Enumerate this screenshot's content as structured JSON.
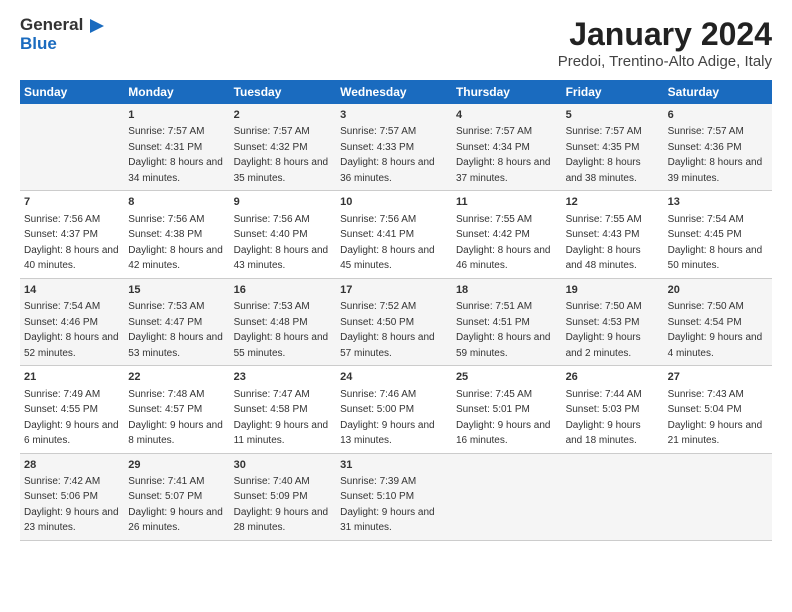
{
  "logo": {
    "line1": "General",
    "line2": "Blue"
  },
  "title": "January 2024",
  "subtitle": "Predoi, Trentino-Alto Adige, Italy",
  "headers": [
    "Sunday",
    "Monday",
    "Tuesday",
    "Wednesday",
    "Thursday",
    "Friday",
    "Saturday"
  ],
  "weeks": [
    [
      {
        "num": "",
        "sunrise": "",
        "sunset": "",
        "daylight": ""
      },
      {
        "num": "1",
        "sunrise": "Sunrise: 7:57 AM",
        "sunset": "Sunset: 4:31 PM",
        "daylight": "Daylight: 8 hours and 34 minutes."
      },
      {
        "num": "2",
        "sunrise": "Sunrise: 7:57 AM",
        "sunset": "Sunset: 4:32 PM",
        "daylight": "Daylight: 8 hours and 35 minutes."
      },
      {
        "num": "3",
        "sunrise": "Sunrise: 7:57 AM",
        "sunset": "Sunset: 4:33 PM",
        "daylight": "Daylight: 8 hours and 36 minutes."
      },
      {
        "num": "4",
        "sunrise": "Sunrise: 7:57 AM",
        "sunset": "Sunset: 4:34 PM",
        "daylight": "Daylight: 8 hours and 37 minutes."
      },
      {
        "num": "5",
        "sunrise": "Sunrise: 7:57 AM",
        "sunset": "Sunset: 4:35 PM",
        "daylight": "Daylight: 8 hours and 38 minutes."
      },
      {
        "num": "6",
        "sunrise": "Sunrise: 7:57 AM",
        "sunset": "Sunset: 4:36 PM",
        "daylight": "Daylight: 8 hours and 39 minutes."
      }
    ],
    [
      {
        "num": "7",
        "sunrise": "Sunrise: 7:56 AM",
        "sunset": "Sunset: 4:37 PM",
        "daylight": "Daylight: 8 hours and 40 minutes."
      },
      {
        "num": "8",
        "sunrise": "Sunrise: 7:56 AM",
        "sunset": "Sunset: 4:38 PM",
        "daylight": "Daylight: 8 hours and 42 minutes."
      },
      {
        "num": "9",
        "sunrise": "Sunrise: 7:56 AM",
        "sunset": "Sunset: 4:40 PM",
        "daylight": "Daylight: 8 hours and 43 minutes."
      },
      {
        "num": "10",
        "sunrise": "Sunrise: 7:56 AM",
        "sunset": "Sunset: 4:41 PM",
        "daylight": "Daylight: 8 hours and 45 minutes."
      },
      {
        "num": "11",
        "sunrise": "Sunrise: 7:55 AM",
        "sunset": "Sunset: 4:42 PM",
        "daylight": "Daylight: 8 hours and 46 minutes."
      },
      {
        "num": "12",
        "sunrise": "Sunrise: 7:55 AM",
        "sunset": "Sunset: 4:43 PM",
        "daylight": "Daylight: 8 hours and 48 minutes."
      },
      {
        "num": "13",
        "sunrise": "Sunrise: 7:54 AM",
        "sunset": "Sunset: 4:45 PM",
        "daylight": "Daylight: 8 hours and 50 minutes."
      }
    ],
    [
      {
        "num": "14",
        "sunrise": "Sunrise: 7:54 AM",
        "sunset": "Sunset: 4:46 PM",
        "daylight": "Daylight: 8 hours and 52 minutes."
      },
      {
        "num": "15",
        "sunrise": "Sunrise: 7:53 AM",
        "sunset": "Sunset: 4:47 PM",
        "daylight": "Daylight: 8 hours and 53 minutes."
      },
      {
        "num": "16",
        "sunrise": "Sunrise: 7:53 AM",
        "sunset": "Sunset: 4:48 PM",
        "daylight": "Daylight: 8 hours and 55 minutes."
      },
      {
        "num": "17",
        "sunrise": "Sunrise: 7:52 AM",
        "sunset": "Sunset: 4:50 PM",
        "daylight": "Daylight: 8 hours and 57 minutes."
      },
      {
        "num": "18",
        "sunrise": "Sunrise: 7:51 AM",
        "sunset": "Sunset: 4:51 PM",
        "daylight": "Daylight: 8 hours and 59 minutes."
      },
      {
        "num": "19",
        "sunrise": "Sunrise: 7:50 AM",
        "sunset": "Sunset: 4:53 PM",
        "daylight": "Daylight: 9 hours and 2 minutes."
      },
      {
        "num": "20",
        "sunrise": "Sunrise: 7:50 AM",
        "sunset": "Sunset: 4:54 PM",
        "daylight": "Daylight: 9 hours and 4 minutes."
      }
    ],
    [
      {
        "num": "21",
        "sunrise": "Sunrise: 7:49 AM",
        "sunset": "Sunset: 4:55 PM",
        "daylight": "Daylight: 9 hours and 6 minutes."
      },
      {
        "num": "22",
        "sunrise": "Sunrise: 7:48 AM",
        "sunset": "Sunset: 4:57 PM",
        "daylight": "Daylight: 9 hours and 8 minutes."
      },
      {
        "num": "23",
        "sunrise": "Sunrise: 7:47 AM",
        "sunset": "Sunset: 4:58 PM",
        "daylight": "Daylight: 9 hours and 11 minutes."
      },
      {
        "num": "24",
        "sunrise": "Sunrise: 7:46 AM",
        "sunset": "Sunset: 5:00 PM",
        "daylight": "Daylight: 9 hours and 13 minutes."
      },
      {
        "num": "25",
        "sunrise": "Sunrise: 7:45 AM",
        "sunset": "Sunset: 5:01 PM",
        "daylight": "Daylight: 9 hours and 16 minutes."
      },
      {
        "num": "26",
        "sunrise": "Sunrise: 7:44 AM",
        "sunset": "Sunset: 5:03 PM",
        "daylight": "Daylight: 9 hours and 18 minutes."
      },
      {
        "num": "27",
        "sunrise": "Sunrise: 7:43 AM",
        "sunset": "Sunset: 5:04 PM",
        "daylight": "Daylight: 9 hours and 21 minutes."
      }
    ],
    [
      {
        "num": "28",
        "sunrise": "Sunrise: 7:42 AM",
        "sunset": "Sunset: 5:06 PM",
        "daylight": "Daylight: 9 hours and 23 minutes."
      },
      {
        "num": "29",
        "sunrise": "Sunrise: 7:41 AM",
        "sunset": "Sunset: 5:07 PM",
        "daylight": "Daylight: 9 hours and 26 minutes."
      },
      {
        "num": "30",
        "sunrise": "Sunrise: 7:40 AM",
        "sunset": "Sunset: 5:09 PM",
        "daylight": "Daylight: 9 hours and 28 minutes."
      },
      {
        "num": "31",
        "sunrise": "Sunrise: 7:39 AM",
        "sunset": "Sunset: 5:10 PM",
        "daylight": "Daylight: 9 hours and 31 minutes."
      },
      {
        "num": "",
        "sunrise": "",
        "sunset": "",
        "daylight": ""
      },
      {
        "num": "",
        "sunrise": "",
        "sunset": "",
        "daylight": ""
      },
      {
        "num": "",
        "sunrise": "",
        "sunset": "",
        "daylight": ""
      }
    ]
  ]
}
